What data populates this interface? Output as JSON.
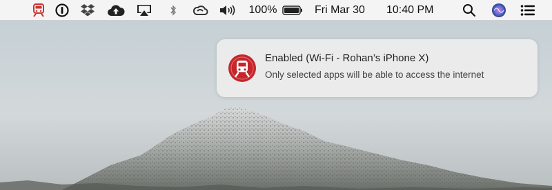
{
  "menubar": {
    "icons": [
      {
        "name": "train-app-icon",
        "color": "#d0312d"
      },
      {
        "name": "onepassword-icon"
      },
      {
        "name": "dropbox-icon"
      },
      {
        "name": "icloud-upload-icon"
      },
      {
        "name": "airplay-icon"
      },
      {
        "name": "bluetooth-icon"
      },
      {
        "name": "creative-cloud-icon"
      },
      {
        "name": "volume-icon"
      }
    ],
    "battery_percent": "100%",
    "battery_level": 1.0,
    "date": "Fri Mar 30",
    "time": "10:40 PM",
    "right_icons": [
      {
        "name": "spotlight-search-icon"
      },
      {
        "name": "siri-icon"
      },
      {
        "name": "notification-center-icon"
      }
    ]
  },
  "notification": {
    "app_icon": "train-app-icon",
    "accent_color": "#c4262b",
    "title": "Enabled (Wi-Fi - Rohan’s iPhone X)",
    "body": "Only selected apps will be able to access the internet"
  }
}
